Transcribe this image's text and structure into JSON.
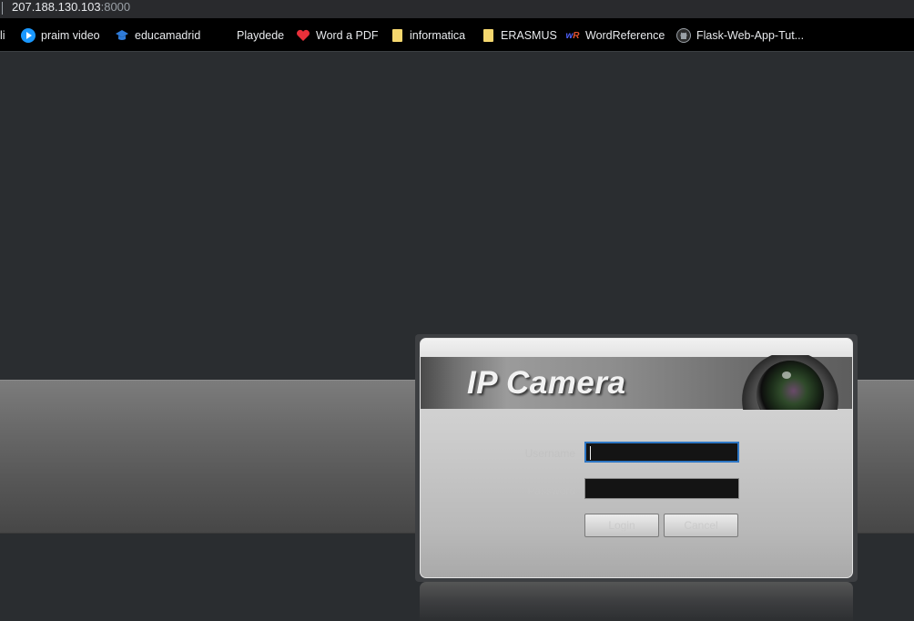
{
  "browser": {
    "url_host": "207.188.130.103",
    "url_port": ":8000"
  },
  "bookmarks": [
    {
      "label": "li",
      "icon": "bookmark-fragment"
    },
    {
      "label": "praim video",
      "icon": "play-icon"
    },
    {
      "label": "educamadrid",
      "icon": "graduation-cap-icon"
    },
    {
      "label": "Playdede",
      "icon": "none"
    },
    {
      "label": "Word a PDF",
      "icon": "heart-icon"
    },
    {
      "label": "informatica",
      "icon": "folder-icon"
    },
    {
      "label": "ERASMUS",
      "icon": "folder-icon"
    },
    {
      "label": "WordReference",
      "icon": "wordreference-icon"
    },
    {
      "label": "Flask-Web-App-Tut...",
      "icon": "github-icon"
    }
  ],
  "login": {
    "brand": "IP Camera",
    "username_label": "Username",
    "password_label": "Password",
    "username_value": "",
    "password_value": "",
    "login_button": "Login",
    "cancel_button": "Cancel"
  },
  "colors": {
    "accent_focus": "#2d76c4",
    "folder": "#f5d76e",
    "heart": "#e8303a",
    "play": "#1a98ff"
  }
}
